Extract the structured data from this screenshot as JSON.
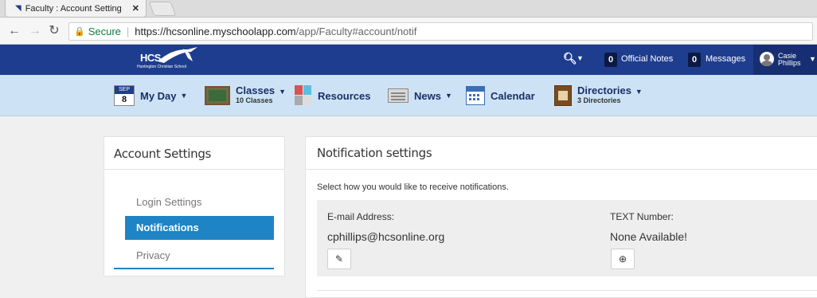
{
  "browser": {
    "tab_title": "Faculty : Account Setting",
    "tab_close": "✕",
    "secure_label": "Secure",
    "url_host": "https://hcsonline.myschoolapp.com",
    "url_path": "/app/Faculty#account/notif"
  },
  "header": {
    "logo_text": "HCS",
    "logo_subtext": "Huntington Christian School",
    "official_notes_count": "0",
    "official_notes_label": "Official Notes",
    "messages_count": "0",
    "messages_label": "Messages",
    "user_first": "Casie",
    "user_last": "Phillips"
  },
  "modules": {
    "myday": {
      "month": "SEP",
      "day": "8",
      "label": "My Day"
    },
    "classes": {
      "label": "Classes",
      "sub": "10 Classes"
    },
    "resources": {
      "label": "Resources"
    },
    "news": {
      "label": "News"
    },
    "calendar": {
      "label": "Calendar"
    },
    "directories": {
      "label": "Directories",
      "sub": "3 Directories"
    }
  },
  "account": {
    "title": "Account Settings",
    "items": [
      {
        "label": "Login Settings"
      },
      {
        "label": "Notifications"
      },
      {
        "label": "Privacy"
      }
    ],
    "active_index": 1
  },
  "notifications": {
    "title": "Notification settings",
    "intro": "Select how you would like to receive notifications.",
    "email_label": "E-mail Address:",
    "email_value": "cphillips@hcsonline.org",
    "text_label": "TEXT Number:",
    "text_value": "None Available!"
  },
  "icons": {
    "edit": "pencil-icon",
    "add": "plus-circle-icon"
  },
  "colors": {
    "header_bg": "#1e3d8f",
    "modnav_bg": "#cde3f5",
    "active_item": "#1e84c5"
  }
}
